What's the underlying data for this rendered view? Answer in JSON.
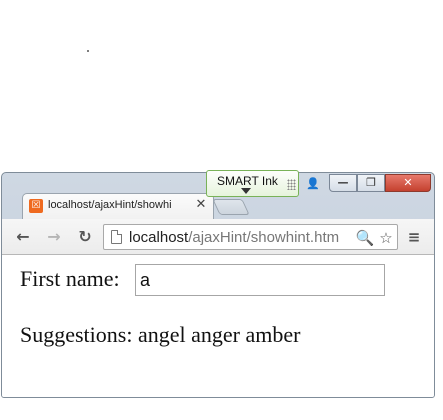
{
  "browser": {
    "tab": {
      "favicon_glyph": "☒",
      "favicon_color": "#ef6a1f",
      "title": "localhost/ajaxHint/showhi",
      "close_glyph": "✕"
    },
    "window_controls": {
      "profile_glyph": "👤",
      "minimize_glyph": "—",
      "maximize_glyph": "❐",
      "close_glyph": "✕"
    },
    "toolbar": {
      "back_glyph": "←",
      "forward_glyph": "→",
      "reload_glyph": "↻",
      "url_host": "localhost",
      "url_path": "/ajaxHint/showhint.htm",
      "zoom_glyph": "🔍",
      "bookmark_glyph": "☆",
      "menu_glyph": "≡"
    }
  },
  "page": {
    "first_name_label": "First name:",
    "first_name_value": "a",
    "suggestions_text": "Suggestions: angel anger amber"
  },
  "smart_ink": {
    "label": "SMART Ink",
    "accent_color": "#79b258"
  }
}
